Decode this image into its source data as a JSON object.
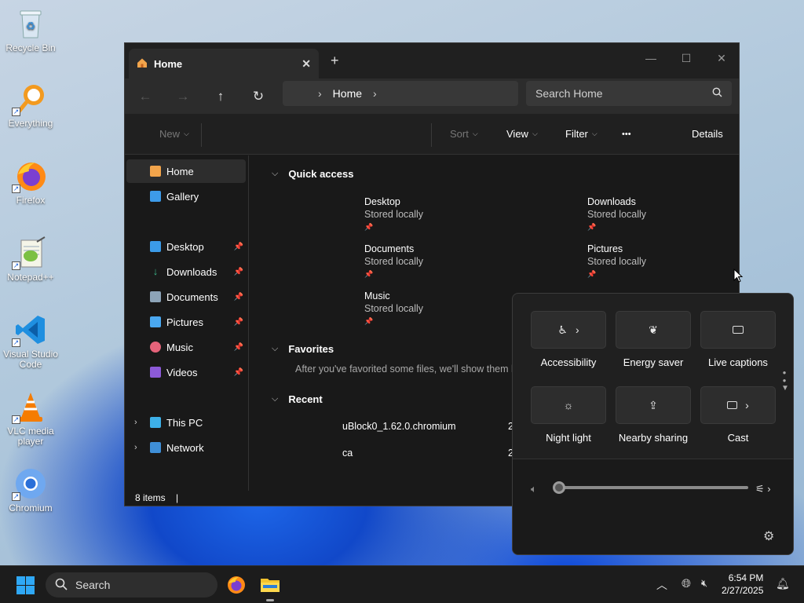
{
  "desktop": {
    "icons": [
      {
        "label": "Recycle Bin"
      },
      {
        "label": "Everything"
      },
      {
        "label": "Firefox"
      },
      {
        "label": "Notepad++"
      },
      {
        "label": "Visual Studio Code"
      },
      {
        "label": "VLC media player"
      },
      {
        "label": "Chromium"
      }
    ]
  },
  "explorer": {
    "tab": {
      "label": "Home"
    },
    "new_tab": "+",
    "address": {
      "crumb": "Home"
    },
    "search": {
      "placeholder": "Search Home"
    },
    "toolbar": {
      "new": "New",
      "sort": "Sort",
      "view": "View",
      "filter": "Filter",
      "more": "•••",
      "details": "Details"
    },
    "sidebar": {
      "top": [
        {
          "label": "Home"
        },
        {
          "label": "Gallery"
        }
      ],
      "pinned": [
        {
          "label": "Desktop"
        },
        {
          "label": "Downloads"
        },
        {
          "label": "Documents"
        },
        {
          "label": "Pictures"
        },
        {
          "label": "Music"
        },
        {
          "label": "Videos"
        }
      ],
      "drives": [
        {
          "label": "This PC"
        },
        {
          "label": "Network"
        }
      ]
    },
    "main": {
      "quick_access": {
        "title": "Quick access",
        "items": [
          {
            "name": "Desktop",
            "sub": "Stored locally"
          },
          {
            "name": "Downloads",
            "sub": "Stored locally"
          },
          {
            "name": "Documents",
            "sub": "Stored locally"
          },
          {
            "name": "Pictures",
            "sub": "Stored locally"
          },
          {
            "name": "Music",
            "sub": "Stored locally"
          }
        ]
      },
      "favorites": {
        "title": "Favorites",
        "empty_text": "After you've favorited some files, we'll show them here."
      },
      "recent": {
        "title": "Recent",
        "items": [
          {
            "name": "uBlock0_1.62.0.chromium",
            "date": "2"
          },
          {
            "name": "ca",
            "date": "2"
          }
        ]
      }
    },
    "status": {
      "count": "8 items"
    }
  },
  "quick_settings": {
    "tiles": [
      {
        "label": "Accessibility",
        "icon": "accessibility-icon"
      },
      {
        "label": "Energy saver",
        "icon": "leaf-icon"
      },
      {
        "label": "Live captions",
        "icon": "captions-icon"
      },
      {
        "label": "Night light",
        "icon": "brightness-icon"
      },
      {
        "label": "Nearby sharing",
        "icon": "share-icon"
      },
      {
        "label": "Cast",
        "icon": "cast-icon"
      }
    ],
    "volume": 0
  },
  "taskbar": {
    "search_placeholder": "Search",
    "time": "6:54 PM",
    "date": "2/27/2025"
  }
}
